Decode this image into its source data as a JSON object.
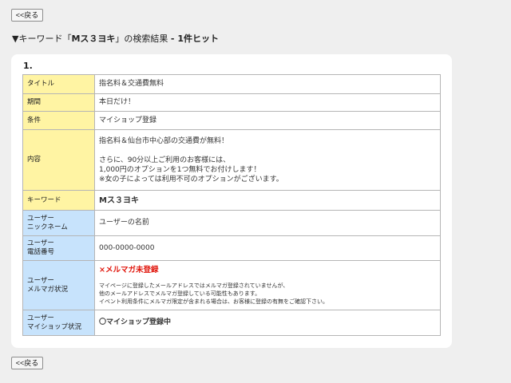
{
  "nav": {
    "back_label": "<<戻る"
  },
  "heading": {
    "prefix": "▼キーワード「",
    "keyword": "Mス３ヨキ",
    "suffix": "」の検索結果 ",
    "count": "- 1件ヒット"
  },
  "result": {
    "number": "1.",
    "rows": {
      "title": {
        "label": "タイトル",
        "value": "指名料＆交通費無料"
      },
      "period": {
        "label": "期間",
        "value": "本日だけ！"
      },
      "condition": {
        "label": "条件",
        "value": "マイショップ登録"
      },
      "content": {
        "label": "内容",
        "lines": [
          "指名料＆仙台市中心部の交通費が無料！",
          "",
          "さらに、90分以上ご利用のお客様には、",
          "1,000円のオプションを1つ無料でお付けします！",
          "※女の子によっては利用不可のオプションがございます。"
        ]
      },
      "keyword": {
        "label": "キーワード",
        "value": "Mス３ヨキ"
      },
      "nickname": {
        "label_line1": "ユーザー",
        "label_line2": "ニックネーム",
        "value": "ユーザーの名前"
      },
      "phone": {
        "label_line1": "ユーザー",
        "label_line2": "電話番号",
        "value": "000-0000-0000"
      },
      "mailmag": {
        "label_line1": "ユーザー",
        "label_line2": "メルマガ状況",
        "status": "×メルマガ未登録",
        "notes": [
          "マイページに登録したメールアドレスではメルマガ登録されていませんが、",
          "他のメールアドレスでメルマガ登録している可能性もあります。",
          "イベント利用条件にメルマガ限定が含まれる場合は、お客様に登録の有無をご確認下さい。"
        ]
      },
      "myshop": {
        "label_line1": "ユーザー",
        "label_line2": "マイショップ状況",
        "status": "〇マイショップ登録中"
      }
    }
  },
  "colors": {
    "label_yellow": "#fff4a3",
    "label_blue": "#c7e3fc",
    "status_red": "#e1190f",
    "status_green": "#34b323"
  }
}
